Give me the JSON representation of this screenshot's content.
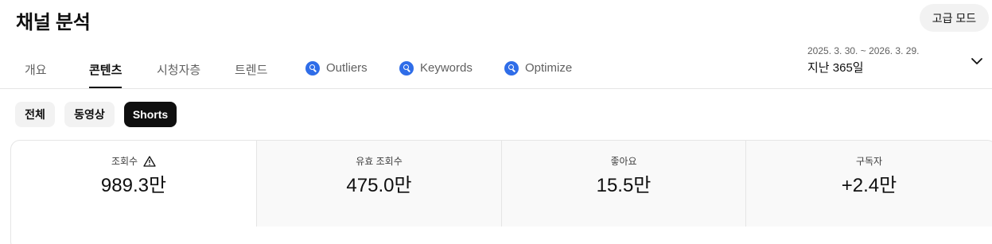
{
  "header": {
    "title": "채널 분석",
    "advanced_mode_label": "고급 모드"
  },
  "tabs": [
    {
      "label": "개요",
      "active": false,
      "icon": null
    },
    {
      "label": "콘텐츠",
      "active": true,
      "icon": null
    },
    {
      "label": "시청자층",
      "active": false,
      "icon": null
    },
    {
      "label": "트렌드",
      "active": false,
      "icon": null
    },
    {
      "label": "Outliers",
      "active": false,
      "icon": "magnifier-badge-icon"
    },
    {
      "label": "Keywords",
      "active": false,
      "icon": "magnifier-badge-icon"
    },
    {
      "label": "Optimize",
      "active": false,
      "icon": "magnifier-badge-icon"
    }
  ],
  "date_range": {
    "range_text": "2025. 3. 30. ~ 2026. 3. 29.",
    "label": "지난 365일",
    "icon": "chevron-down-icon"
  },
  "content_filters": [
    {
      "label": "전체",
      "selected": false
    },
    {
      "label": "동영상",
      "selected": false
    },
    {
      "label": "Shorts",
      "selected": true
    }
  ],
  "metrics": [
    {
      "label": "조회수",
      "value": "989.3만",
      "warning_icon": true
    },
    {
      "label": "유효 조회수",
      "value": "475.0만",
      "warning_icon": false
    },
    {
      "label": "좋아요",
      "value": "15.5만",
      "warning_icon": false
    },
    {
      "label": "구독자",
      "value": "+2.4만",
      "warning_icon": false
    }
  ],
  "colors": {
    "accent_icon": "#2f6de8",
    "selected_chip": "#0f0f0f",
    "chip_bg": "#f2f2f2"
  }
}
